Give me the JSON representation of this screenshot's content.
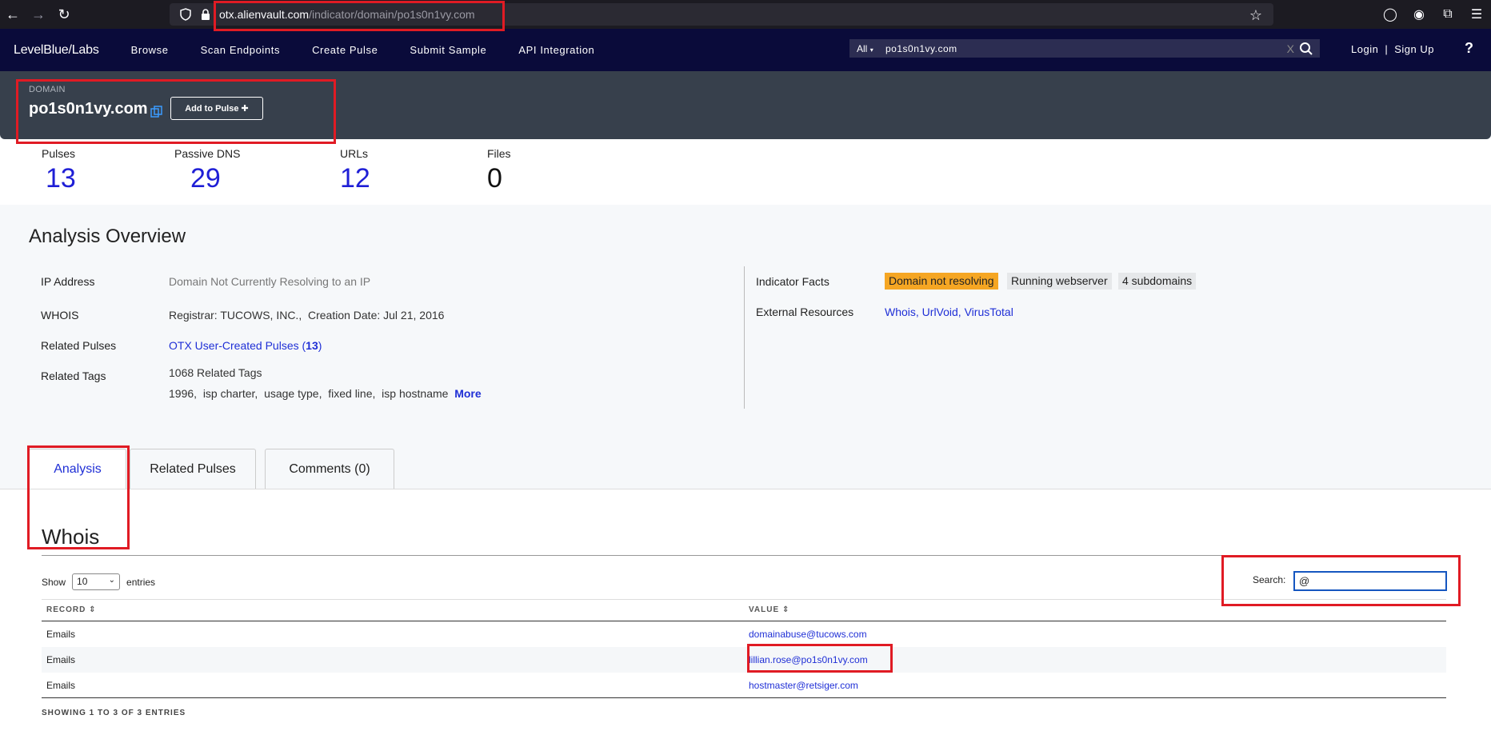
{
  "browser": {
    "url_host": "otx.alienvault.com",
    "url_path": "/indicator/domain/po1s0n1vy.com"
  },
  "topnav": {
    "logo_brand": "LevelBlue",
    "logo_labs": "/Labs",
    "links": [
      "Browse",
      "Scan Endpoints",
      "Create Pulse",
      "Submit Sample",
      "API Integration"
    ],
    "search_scope": "All",
    "search_query": "po1s0n1vy.com",
    "clear_glyph": "X",
    "login": "Login",
    "separator": "|",
    "signup": "Sign Up",
    "help": "?"
  },
  "indicator": {
    "type_label": "DOMAIN",
    "name": "po1s0n1vy.com",
    "add_to_pulse": "Add to Pulse"
  },
  "stats": [
    {
      "label": "Pulses",
      "value": "13"
    },
    {
      "label": "Passive DNS",
      "value": "29"
    },
    {
      "label": "URLs",
      "value": "12"
    },
    {
      "label": "Files",
      "value": "0"
    }
  ],
  "overview": {
    "title": "Analysis Overview",
    "ip_label": "IP Address",
    "ip_value": "Domain Not Currently Resolving to an IP",
    "whois_label": "WHOIS",
    "whois_value": "Registrar: TUCOWS, INC.,  Creation Date: Jul 21, 2016",
    "related_pulses_label": "Related Pulses",
    "related_pulses_link": "OTX User-Created Pulses",
    "related_pulses_count": "13",
    "related_tags_label": "Related Tags",
    "related_tags_count": "1068 Related Tags",
    "related_tags_list": "1996,  isp charter,  usage type,  fixed line,  isp hostname",
    "more": "More",
    "facts_label": "Indicator Facts",
    "facts": [
      "Domain not resolving",
      "Running webserver",
      "4 subdomains"
    ],
    "external_label": "External Resources",
    "external_links": "Whois, UrlVoid, VirusTotal"
  },
  "tabs": [
    "Analysis",
    "Related Pulses",
    "Comments (0)"
  ],
  "whois": {
    "title": "Whois",
    "show_label": "Show",
    "show_value": "10",
    "entries_label": "entries",
    "search_label": "Search:",
    "search_value": "@",
    "col_record": "RECORD",
    "col_value": "VALUE",
    "rows": [
      {
        "record": "Emails",
        "value": "domainabuse@tucows.com"
      },
      {
        "record": "Emails",
        "value": "lillian.rose@po1s0n1vy.com"
      },
      {
        "record": "Emails",
        "value": "hostmaster@retsiger.com"
      }
    ],
    "info": "SHOWING 1 TO 3 OF 3 ENTRIES"
  },
  "colors": {
    "nav_bg": "#0a0b3a",
    "header_bg": "#37404c",
    "link": "#1f2fd6",
    "warn_tag": "#f5a623",
    "highlight": "#e01b24"
  }
}
